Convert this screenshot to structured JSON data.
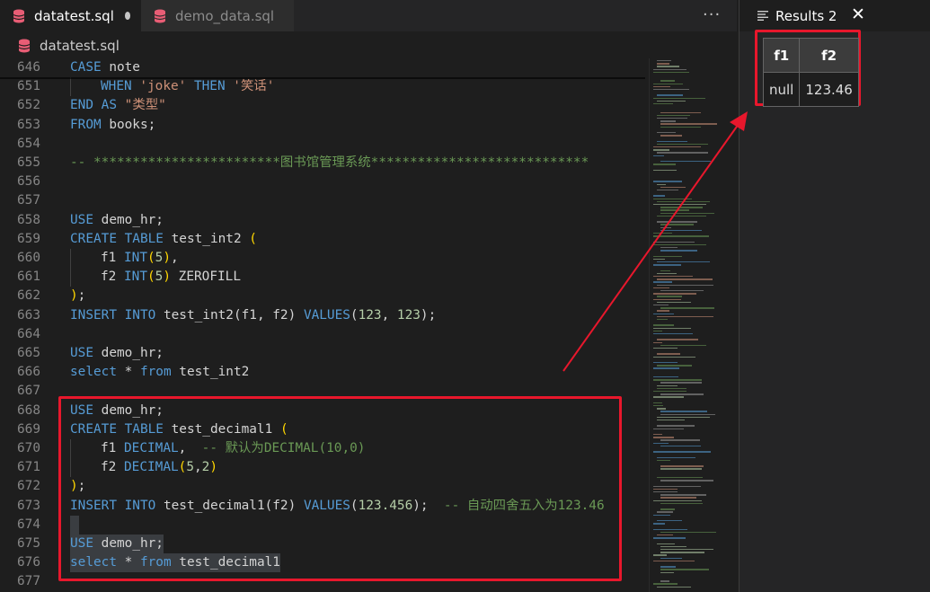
{
  "tabs": [
    {
      "label": "datatest.sql",
      "active": true,
      "modified": true
    },
    {
      "label": "demo_data.sql",
      "active": false,
      "modified": false
    }
  ],
  "breadcrumb": "datatest.sql",
  "more_actions_icon": "ellipsis-icon",
  "colors": {
    "keyword": "#569cd6",
    "string": "#ce9178",
    "number": "#b5cea8",
    "comment": "#6a9955",
    "bracket": "#ffd700",
    "highlight": "#e8172c",
    "db_icon": "#e85d75"
  },
  "code_lines": [
    {
      "n": "646",
      "tokens": [
        [
          "kw",
          "CASE"
        ],
        [
          "id",
          " note"
        ]
      ]
    },
    {
      "n": "651",
      "tokens": [
        [
          "ig",
          ""
        ],
        [
          "kw",
          "WHEN "
        ],
        [
          "str",
          "'joke'"
        ],
        [
          "kw",
          " THEN "
        ],
        [
          "str",
          "'笑话'"
        ]
      ]
    },
    {
      "n": "652",
      "tokens": [
        [
          "kw",
          "END AS "
        ],
        [
          "str",
          "\"类型\""
        ]
      ]
    },
    {
      "n": "653",
      "tokens": [
        [
          "kw",
          "FROM"
        ],
        [
          "id",
          " books;"
        ]
      ]
    },
    {
      "n": "654",
      "tokens": []
    },
    {
      "n": "655",
      "tokens": [
        [
          "cmt",
          "-- ************************图书馆管理系统****************************"
        ]
      ]
    },
    {
      "n": "656",
      "tokens": []
    },
    {
      "n": "657",
      "tokens": []
    },
    {
      "n": "658",
      "tokens": [
        [
          "kw",
          "USE"
        ],
        [
          "id",
          " demo_hr;"
        ]
      ]
    },
    {
      "n": "659",
      "tokens": [
        [
          "kw",
          "CREATE TABLE"
        ],
        [
          "id",
          " test_int2 "
        ],
        [
          "par",
          "("
        ]
      ]
    },
    {
      "n": "660",
      "tokens": [
        [
          "ig",
          ""
        ],
        [
          "id",
          "f1 "
        ],
        [
          "kw",
          "INT"
        ],
        [
          "par",
          "("
        ],
        [
          "num",
          "5"
        ],
        [
          "par",
          ")"
        ],
        [
          "id",
          ","
        ]
      ]
    },
    {
      "n": "661",
      "tokens": [
        [
          "ig",
          ""
        ],
        [
          "id",
          "f2 "
        ],
        [
          "kw",
          "INT"
        ],
        [
          "par",
          "("
        ],
        [
          "num",
          "5"
        ],
        [
          "par",
          ")"
        ],
        [
          "id",
          " ZEROFILL"
        ]
      ]
    },
    {
      "n": "662",
      "tokens": [
        [
          "par",
          ")"
        ],
        [
          "id",
          ";"
        ]
      ]
    },
    {
      "n": "663",
      "tokens": [
        [
          "kw",
          "INSERT INTO"
        ],
        [
          "id",
          " test_int2(f1, f2) "
        ],
        [
          "kw",
          "VALUES"
        ],
        [
          "id",
          "("
        ],
        [
          "num",
          "123"
        ],
        [
          "id",
          ", "
        ],
        [
          "num",
          "123"
        ],
        [
          "id",
          ");"
        ]
      ]
    },
    {
      "n": "664",
      "tokens": []
    },
    {
      "n": "665",
      "tokens": [
        [
          "kw",
          "USE"
        ],
        [
          "id",
          " demo_hr;"
        ]
      ]
    },
    {
      "n": "666",
      "tokens": [
        [
          "kw",
          "select"
        ],
        [
          "id",
          " * "
        ],
        [
          "kw",
          "from"
        ],
        [
          "id",
          " test_int2"
        ]
      ]
    },
    {
      "n": "667",
      "tokens": []
    },
    {
      "n": "668",
      "tokens": [
        [
          "kw",
          "USE"
        ],
        [
          "id",
          " demo_hr;"
        ]
      ]
    },
    {
      "n": "669",
      "tokens": [
        [
          "kw",
          "CREATE TABLE"
        ],
        [
          "id",
          " test_decimal1 "
        ],
        [
          "par",
          "("
        ]
      ]
    },
    {
      "n": "670",
      "tokens": [
        [
          "ig",
          ""
        ],
        [
          "id",
          "f1 "
        ],
        [
          "kw",
          "DECIMAL"
        ],
        [
          "id",
          ",  "
        ],
        [
          "cmt",
          "-- 默认为DECIMAL(10,0)"
        ]
      ]
    },
    {
      "n": "671",
      "tokens": [
        [
          "ig",
          ""
        ],
        [
          "id",
          "f2 "
        ],
        [
          "kw",
          "DECIMAL"
        ],
        [
          "par",
          "("
        ],
        [
          "num",
          "5"
        ],
        [
          "id",
          ","
        ],
        [
          "num",
          "2"
        ],
        [
          "par",
          ")"
        ]
      ]
    },
    {
      "n": "672",
      "tokens": [
        [
          "par",
          ")"
        ],
        [
          "id",
          ";"
        ]
      ]
    },
    {
      "n": "673",
      "tokens": [
        [
          "kw",
          "INSERT INTO"
        ],
        [
          "id",
          " test_decimal1(f2) "
        ],
        [
          "kw",
          "VALUES"
        ],
        [
          "id",
          "("
        ],
        [
          "num",
          "123.456"
        ],
        [
          "id",
          ");  "
        ],
        [
          "cmt",
          "-- 自动四舍五入为123.46"
        ]
      ]
    },
    {
      "n": "674",
      "tokens": [],
      "selected": true
    },
    {
      "n": "675",
      "tokens": [
        [
          "kw",
          "USE"
        ],
        [
          "id",
          " demo_hr;"
        ]
      ],
      "selected": true
    },
    {
      "n": "676",
      "tokens": [
        [
          "kw",
          "select"
        ],
        [
          "id",
          " * "
        ],
        [
          "kw",
          "from"
        ],
        [
          "id",
          " test_decimal1"
        ]
      ],
      "selected": true
    },
    {
      "n": "677",
      "tokens": []
    }
  ],
  "results": {
    "title": "Results 2",
    "title_icon": "lines-icon",
    "close_icon": "close-icon",
    "columns": [
      "f1",
      "f2"
    ],
    "rows": [
      [
        "null",
        "123.46"
      ]
    ]
  }
}
